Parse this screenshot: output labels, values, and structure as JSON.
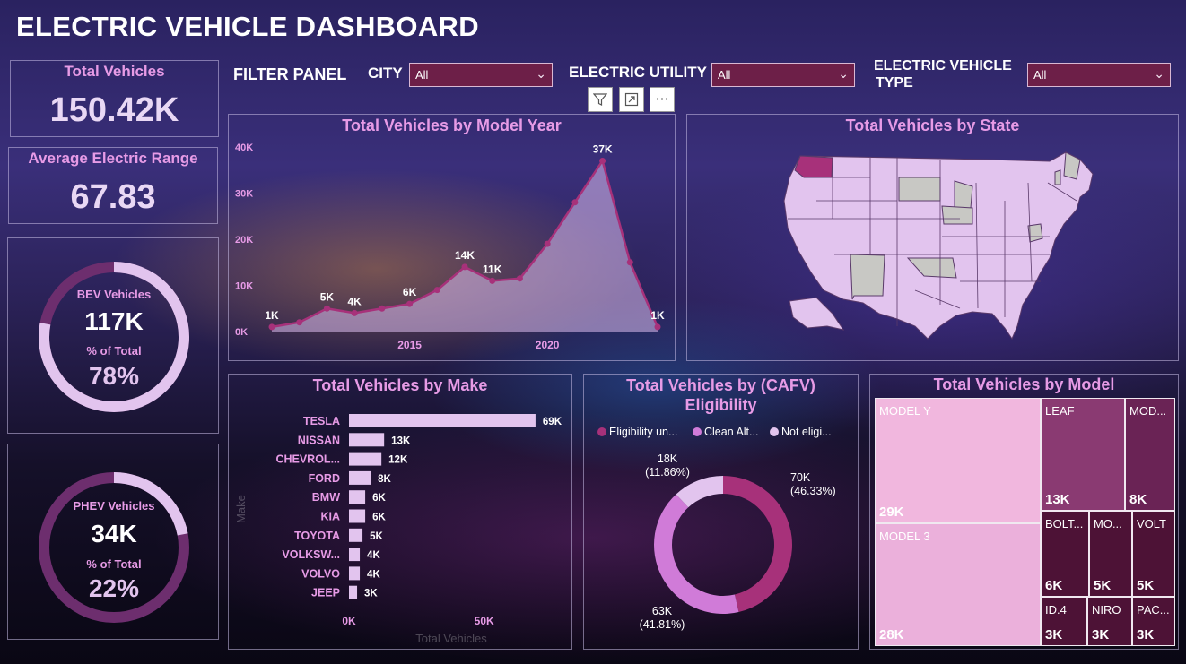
{
  "header": {
    "title": "ELECTRIC VEHICLE DASHBOARD"
  },
  "kpis": {
    "total_vehicles": {
      "label": "Total Vehicles",
      "value": "150.42K"
    },
    "avg_range": {
      "label": "Average Electric Range",
      "value": "67.83"
    },
    "bev": {
      "label": "BEV Vehicles",
      "value": "117K",
      "pct_label": "% of Total",
      "pct": "78%",
      "share": 0.78
    },
    "phev": {
      "label": "PHEV Vehicles",
      "value": "34K",
      "pct_label": "% of Total",
      "pct": "22%",
      "share": 0.22
    }
  },
  "filters": {
    "panel_label": "FILTER PANEL",
    "city": {
      "label": "CITY",
      "value": "All"
    },
    "utility": {
      "label": "ELECTRIC UTILITY",
      "value": "All"
    },
    "ev_type": {
      "label_line1": "ELECTRIC VEHICLE",
      "label_line2": "TYPE",
      "value": "All"
    }
  },
  "visual_tools": {
    "filter": "filter-icon",
    "focus": "focus-mode-icon",
    "more": "more-options-icon"
  },
  "colors": {
    "accent": "#e79be6",
    "dark": "#a7317a",
    "light": "#e2c4ee",
    "mid": "#d07bd8",
    "maroon": "#6d1f48"
  },
  "chart_data": [
    {
      "id": "model_year",
      "type": "area",
      "title": "Total Vehicles by Model Year",
      "x": [
        2010,
        2011,
        2012,
        2013,
        2014,
        2015,
        2016,
        2017,
        2018,
        2019,
        2020,
        2021,
        2022,
        2023,
        2024
      ],
      "values": [
        1000,
        2000,
        5000,
        4000,
        5000,
        6000,
        9000,
        14000,
        11000,
        11500,
        19000,
        28000,
        37000,
        15000,
        1000
      ],
      "point_labels": [
        "1K",
        "",
        "5K",
        "4K",
        "",
        "6K",
        "",
        "14K",
        "11K",
        "",
        "",
        "",
        "37K",
        "",
        "1K"
      ],
      "x_ticks": [
        "2015",
        "2020"
      ],
      "y_ticks": [
        "0K",
        "10K",
        "20K",
        "30K",
        "40K"
      ],
      "ylim": [
        0,
        40000
      ]
    },
    {
      "id": "state_map",
      "type": "map",
      "title": "Total Vehicles by State",
      "highlight": "WA"
    },
    {
      "id": "make",
      "type": "bar",
      "title": "Total Vehicles by Make",
      "categories": [
        "TESLA",
        "NISSAN",
        "CHEVROL...",
        "FORD",
        "BMW",
        "KIA",
        "TOYOTA",
        "VOLKSW...",
        "VOLVO",
        "JEEP"
      ],
      "values": [
        69000,
        13000,
        12000,
        8000,
        6000,
        6000,
        5000,
        4000,
        4000,
        3000
      ],
      "value_labels": [
        "69K",
        "13K",
        "12K",
        "8K",
        "6K",
        "6K",
        "5K",
        "4K",
        "4K",
        "3K"
      ],
      "x_ticks": [
        "0K",
        "50K"
      ],
      "xlabel": "Total Vehicles",
      "ylabel": "Make",
      "xlim": [
        0,
        75000
      ]
    },
    {
      "id": "cafv",
      "type": "pie",
      "title_line1": "Total Vehicles by (CAFV)",
      "title_line2": "Eligibility",
      "legend": [
        "Eligibility un...",
        "Clean Alt...",
        "Not eligi..."
      ],
      "slices": [
        {
          "name": "Eligibility unknown",
          "value": 70000,
          "pct": 46.33,
          "label": "70K",
          "pct_label": "(46.33%)",
          "color": "#a7317a"
        },
        {
          "name": "Clean Alternative Fuel Vehicle Eligible",
          "value": 63000,
          "pct": 41.81,
          "label": "63K",
          "pct_label": "(41.81%)",
          "color": "#d07bd8"
        },
        {
          "name": "Not eligible",
          "value": 18000,
          "pct": 11.86,
          "label": "18K",
          "pct_label": "(11.86%)",
          "color": "#e2c4ee"
        }
      ]
    },
    {
      "id": "model",
      "type": "treemap",
      "title": "Total Vehicles by Model",
      "cells": [
        {
          "name": "MODEL Y",
          "value": "29K"
        },
        {
          "name": "MODEL 3",
          "value": "28K"
        },
        {
          "name": "LEAF",
          "value": "13K"
        },
        {
          "name": "MOD...",
          "value": "8K"
        },
        {
          "name": "BOLT...",
          "value": "6K"
        },
        {
          "name": "MO...",
          "value": "5K"
        },
        {
          "name": "VOLT",
          "value": "5K"
        },
        {
          "name": "ID.4",
          "value": "3K"
        },
        {
          "name": "NIRO",
          "value": "3K"
        },
        {
          "name": "PAC...",
          "value": "3K"
        }
      ]
    }
  ]
}
